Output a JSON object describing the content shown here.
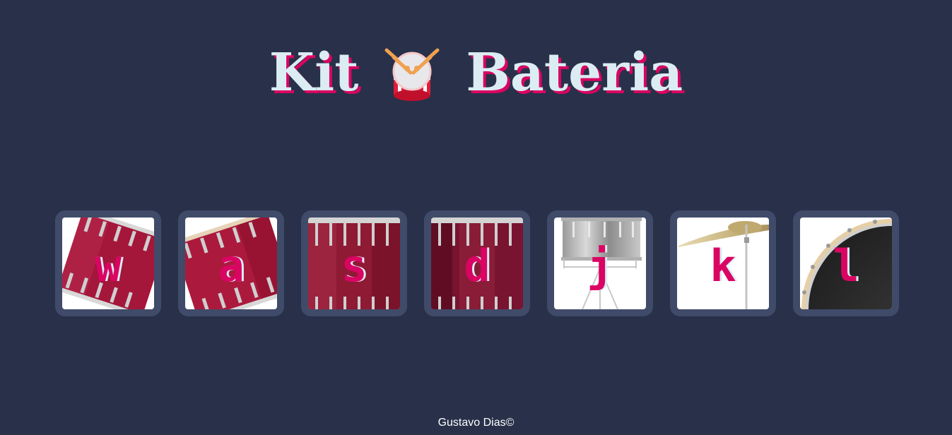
{
  "header": {
    "title_left": "Kit",
    "title_icon": "drum-with-sticks-icon",
    "title_right": "Bateria"
  },
  "drums": [
    {
      "key": "w",
      "icon": "crash-drum-icon"
    },
    {
      "key": "a",
      "icon": "kick-drum-icon"
    },
    {
      "key": "s",
      "icon": "snare-drum-icon"
    },
    {
      "key": "d",
      "icon": "tom-drum-icon"
    },
    {
      "key": "j",
      "icon": "floor-tom-icon"
    },
    {
      "key": "k",
      "icon": "cymbal-icon"
    },
    {
      "key": "l",
      "icon": "bass-drum-icon"
    }
  ],
  "footer": {
    "credit": "Gustavo Dias©"
  },
  "colors": {
    "background": "#283149",
    "key_frame": "#404b69",
    "accent": "#da0463",
    "title_text": "#dbedf3"
  }
}
